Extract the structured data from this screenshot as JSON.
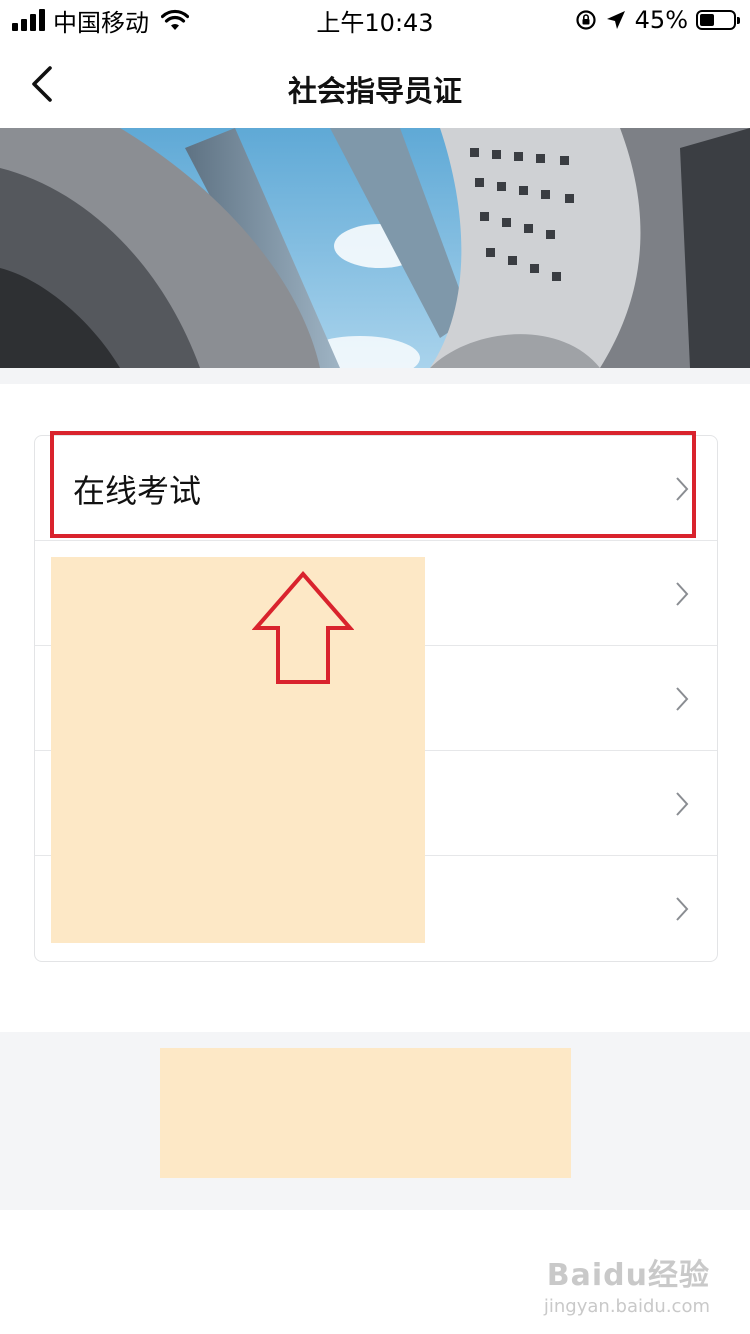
{
  "status_bar": {
    "carrier": "中国移动",
    "time": "上午10:43",
    "battery_percent": "45%",
    "battery_level": 0.45,
    "icons": [
      "signal-icon",
      "wifi-icon",
      "rotation-lock-icon",
      "location-icon",
      "battery-icon"
    ]
  },
  "nav": {
    "title": "社会指导员证",
    "back_icon": "chevron-left-icon"
  },
  "hero": {
    "image": "city-buildings-banner"
  },
  "menu": {
    "items": [
      {
        "label": "在线考试",
        "icon": "chevron-right-icon"
      },
      {
        "label": "",
        "icon": "chevron-right-icon"
      },
      {
        "label": "",
        "icon": "chevron-right-icon"
      },
      {
        "label": "",
        "icon": "chevron-right-icon"
      },
      {
        "label": "",
        "icon": "chevron-right-icon"
      }
    ]
  },
  "annotation": {
    "highlight_color": "#d9232d",
    "arrow_icon": "arrow-up-icon",
    "redaction_color": "#fde8c6"
  },
  "watermark": {
    "logo": "Baidu经验",
    "url": "jingyan.baidu.com"
  }
}
